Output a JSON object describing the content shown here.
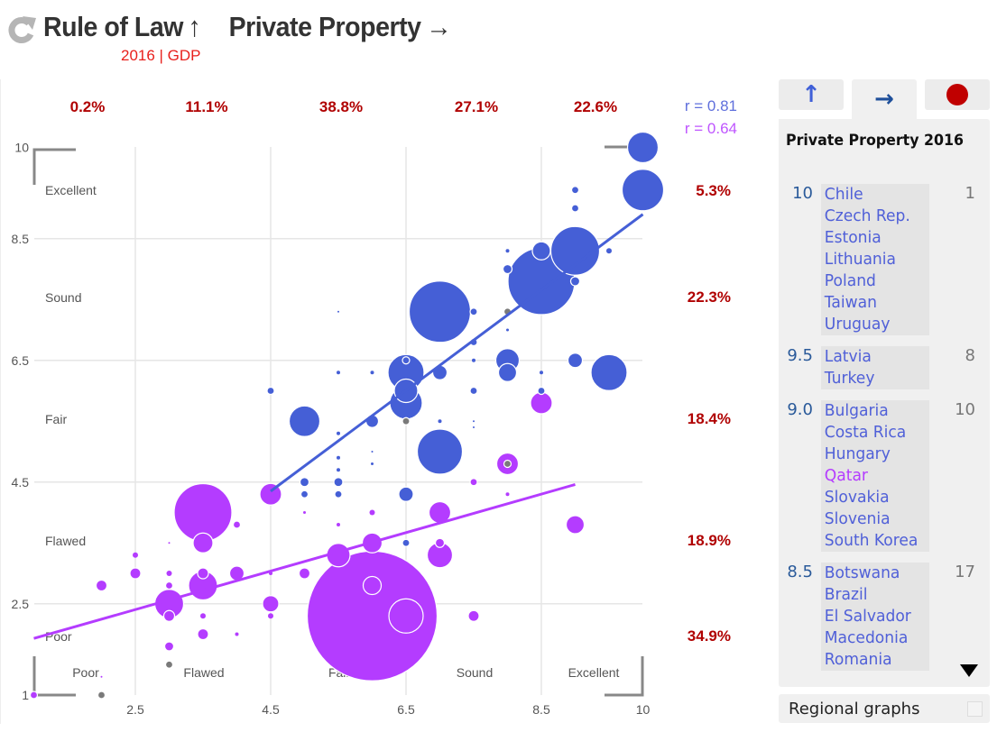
{
  "header": {
    "title_y": "Rule of Law",
    "title_y_arrow": "↑",
    "title_x": "Private Property",
    "title_x_arrow": "→",
    "subtitle": "2016 | GDP",
    "reload_icon": "reload-icon"
  },
  "colors": {
    "series_blue": "#455fd6",
    "series_purple": "#b43cff",
    "grey": "#7a7a7a",
    "pct": "#b00000",
    "subtitle": "#e8201c",
    "r_blue": "#5f6fdc",
    "r_purple": "#bf55ff"
  },
  "chart_data": {
    "type": "scatter",
    "xlim": [
      1,
      10
    ],
    "ylim": [
      1,
      10
    ],
    "x_ticks": [
      "2.5",
      "4.5",
      "6.5",
      "8.5",
      "10"
    ],
    "y_ticks": [
      "1",
      "2.5",
      "4.5",
      "6.5",
      "8.5",
      "10"
    ],
    "x_categories": [
      "Poor",
      "Flawed",
      "Fair",
      "Sound",
      "Excellent"
    ],
    "y_categories": [
      "Excellent",
      "Sound",
      "Fair",
      "Flawed",
      "Poor"
    ],
    "x_bin_pct": [
      "0.2%",
      "11.1%",
      "38.8%",
      "27.1%",
      "22.6%"
    ],
    "y_bin_pct": [
      "5.3%",
      "22.3%",
      "18.4%",
      "18.9%",
      "34.9%"
    ],
    "correlations": [
      "r = 0.81",
      "r = 0.64"
    ],
    "grid": true,
    "trendlines": [
      {
        "series": 0,
        "from": [
          4.5,
          4.35
        ],
        "to": [
          10,
          8.9
        ]
      },
      {
        "series": 1,
        "from": [
          1,
          1.93
        ],
        "to": [
          9,
          4.46
        ]
      }
    ],
    "points_format": [
      "x",
      "y",
      "gdp_relative",
      "series (0 blue, 1 purple, 2 grey)"
    ],
    "points": [
      [
        10,
        10,
        17,
        0
      ],
      [
        10,
        9.3,
        23,
        0
      ],
      [
        9,
        9.3,
        4,
        0
      ],
      [
        9,
        9.0,
        4,
        0
      ],
      [
        8.5,
        7.8,
        37,
        0
      ],
      [
        9,
        8.3,
        27,
        0
      ],
      [
        8.5,
        8.3,
        10,
        0
      ],
      [
        8,
        8.0,
        5,
        0
      ],
      [
        8,
        8.3,
        2,
        0
      ],
      [
        9.5,
        8.3,
        3,
        0
      ],
      [
        9,
        7.8,
        5,
        0
      ],
      [
        7,
        7.3,
        34,
        0
      ],
      [
        7.5,
        7.3,
        4,
        0
      ],
      [
        8,
        7.3,
        4,
        2
      ],
      [
        8,
        7.0,
        1.5,
        0
      ],
      [
        5.5,
        7.3,
        1,
        0
      ],
      [
        7.5,
        6.8,
        4,
        0
      ],
      [
        8,
        6.5,
        13,
        0
      ],
      [
        8,
        6.3,
        10,
        0
      ],
      [
        9,
        6.5,
        8,
        0
      ],
      [
        9.5,
        6.3,
        20,
        0
      ],
      [
        8.5,
        6.3,
        2,
        0
      ],
      [
        6.5,
        6.3,
        20,
        0
      ],
      [
        7,
        6.3,
        8,
        0
      ],
      [
        7.5,
        6.5,
        2,
        0
      ],
      [
        6.5,
        6.5,
        4,
        0
      ],
      [
        5.5,
        6.3,
        2,
        0
      ],
      [
        6,
        6.3,
        2,
        0
      ],
      [
        4.5,
        6.0,
        4,
        0
      ],
      [
        6.5,
        5.8,
        18,
        0
      ],
      [
        6.5,
        6.0,
        13,
        0
      ],
      [
        5,
        5.5,
        17,
        0
      ],
      [
        6,
        5.5,
        7,
        0
      ],
      [
        6.5,
        5.5,
        4,
        2
      ],
      [
        7,
        5.0,
        25,
        0
      ],
      [
        5.5,
        5.3,
        2,
        0
      ],
      [
        5.5,
        4.9,
        2,
        0
      ],
      [
        6,
        5.0,
        1,
        0
      ],
      [
        6,
        4.8,
        1.5,
        0
      ],
      [
        5.5,
        4.7,
        2,
        0
      ],
      [
        7.5,
        6.0,
        4,
        0
      ],
      [
        7.5,
        5.4,
        1,
        0
      ],
      [
        8,
        4.8,
        4,
        2
      ],
      [
        8.5,
        6.0,
        4,
        0
      ],
      [
        5.5,
        4.5,
        5,
        0
      ],
      [
        5,
        4.5,
        5,
        0
      ],
      [
        5,
        4.3,
        4,
        0
      ],
      [
        5.5,
        4.3,
        4,
        0
      ],
      [
        6.5,
        4.3,
        8,
        0
      ],
      [
        7,
        5.5,
        2,
        0
      ],
      [
        7.5,
        5.5,
        1,
        0
      ],
      [
        6.5,
        3.5,
        4,
        0
      ],
      [
        8.5,
        5.8,
        12,
        1
      ],
      [
        8,
        4.8,
        12,
        1
      ],
      [
        7.5,
        4.5,
        4,
        1
      ],
      [
        8,
        4.3,
        2,
        1
      ],
      [
        4.5,
        4.3,
        12,
        1
      ],
      [
        3.5,
        4.0,
        32,
        1
      ],
      [
        3.5,
        3.5,
        11,
        1
      ],
      [
        4,
        3.8,
        4,
        1
      ],
      [
        5,
        4.0,
        1.5,
        1
      ],
      [
        5.5,
        3.8,
        2,
        1
      ],
      [
        6,
        4.0,
        3,
        1
      ],
      [
        7,
        4.0,
        12,
        1
      ],
      [
        9,
        3.8,
        10,
        1
      ],
      [
        5.5,
        3.3,
        13,
        1
      ],
      [
        6,
        3.5,
        11,
        1
      ],
      [
        7,
        3.3,
        14,
        1
      ],
      [
        7,
        3.5,
        5,
        1
      ],
      [
        3,
        3.5,
        1,
        1
      ],
      [
        2.5,
        3.3,
        3,
        1
      ],
      [
        2.5,
        3.0,
        6,
        1
      ],
      [
        3,
        3.0,
        3,
        1
      ],
      [
        3.5,
        3.0,
        6,
        1
      ],
      [
        4,
        3.0,
        8,
        1
      ],
      [
        5,
        3.0,
        6,
        1
      ],
      [
        4.5,
        3.0,
        2,
        1
      ],
      [
        2,
        2.8,
        6,
        1
      ],
      [
        3,
        2.8,
        4,
        1
      ],
      [
        3.5,
        2.8,
        16,
        1
      ],
      [
        3,
        2.5,
        16,
        1
      ],
      [
        4.5,
        2.5,
        9,
        1
      ],
      [
        6,
        2.3,
        72,
        1
      ],
      [
        6,
        2.8,
        10,
        1
      ],
      [
        6.5,
        2.3,
        19,
        1
      ],
      [
        7.5,
        2.3,
        6,
        1
      ],
      [
        3,
        2.3,
        6,
        1
      ],
      [
        3.5,
        2.3,
        3,
        1
      ],
      [
        3.5,
        2.0,
        6,
        1
      ],
      [
        4,
        2.0,
        2,
        1
      ],
      [
        4.5,
        2.3,
        3,
        1
      ],
      [
        3,
        1.8,
        5,
        1
      ],
      [
        3,
        1.5,
        4,
        2
      ],
      [
        2,
        1.3,
        1,
        1
      ],
      [
        1,
        1.0,
        4,
        1
      ],
      [
        2,
        1.0,
        4,
        2
      ]
    ]
  },
  "side_panel": {
    "tabs": [
      {
        "icon": "arrow-up-icon",
        "glyph": "↑"
      },
      {
        "icon": "arrow-right-icon",
        "glyph": "→",
        "active": true
      },
      {
        "icon": "bubble-icon"
      }
    ],
    "title": "Private Property 2016",
    "groups": [
      {
        "value": "10",
        "count": "1",
        "names": [
          "Chile",
          "Czech Rep.",
          "Estonia",
          "Lithuania",
          "Poland",
          "Taiwan",
          "Uruguay"
        ]
      },
      {
        "value": "9.5",
        "count": "8",
        "names": [
          "Latvia",
          "Turkey"
        ]
      },
      {
        "value": "9.0",
        "count": "10",
        "names": [
          "Bulgaria",
          "Costa Rica",
          "Hungary",
          "Qatar",
          "Slovakia",
          "Slovenia",
          "South Korea"
        ],
        "highlight": [
          "Qatar"
        ]
      },
      {
        "value": "8.5",
        "count": "17",
        "names": [
          "Botswana",
          "Brazil",
          "El Salvador",
          "Macedonia",
          "Romania"
        ]
      }
    ],
    "regional_label": "Regional graphs",
    "regional_checked": false
  }
}
